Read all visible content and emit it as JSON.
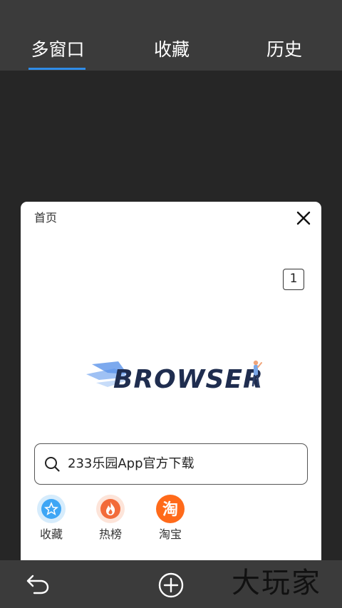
{
  "tabs": {
    "multi_window": "多窗口",
    "favorites": "收藏",
    "history": "历史"
  },
  "window_card": {
    "title": "首页",
    "tab_count": "1",
    "logo_text": "BROWSER",
    "search_text": "233乐园App官方下载",
    "shortcuts": [
      {
        "label": "收藏",
        "icon": "star-icon",
        "color": "#3ea6f5"
      },
      {
        "label": "热榜",
        "icon": "flame-icon",
        "color": "#f26b3a"
      },
      {
        "label": "淘宝",
        "icon": "taobao-icon",
        "color": "#ff6a1a",
        "glyph": "淘"
      }
    ]
  },
  "bottom_bar": {
    "watermark": "大玩家"
  },
  "colors": {
    "accent": "#2f8ce8",
    "background": "#262626",
    "bar": "#3b3b3b"
  }
}
